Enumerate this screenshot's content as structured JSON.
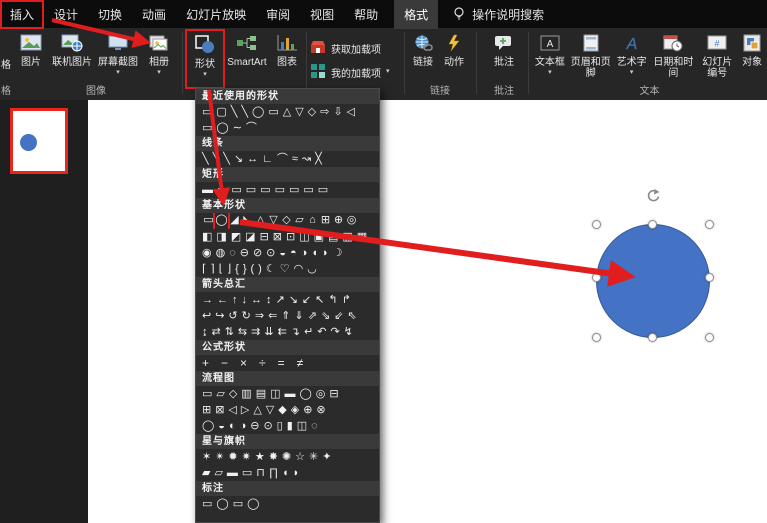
{
  "colors": {
    "annotation_red": "#e11d1d",
    "shape_blue": "#4472c4",
    "titlebar_bg": "#0c0c0c",
    "ribbon_bg": "#262626",
    "dropdown_bg": "#2b2b2b"
  },
  "icons": {
    "caret": "▾"
  },
  "titlebar": {
    "tabs": [
      {
        "label": "插入"
      },
      {
        "label": "设计"
      },
      {
        "label": "切换"
      },
      {
        "label": "动画"
      },
      {
        "label": "幻灯片放映"
      },
      {
        "label": "审阅"
      },
      {
        "label": "视图"
      },
      {
        "label": "帮助"
      },
      {
        "label": "格式"
      }
    ],
    "search_label": "操作说明搜索"
  },
  "ribbon": {
    "partial_button_label": "格",
    "partial_group_label": "格",
    "groups": {
      "images": {
        "label": "图像",
        "buttons": [
          "图片",
          "联机图片",
          "屏幕截图",
          "相册"
        ]
      },
      "illustrations": {
        "buttons": [
          "形状",
          "SmartArt",
          "图表"
        ]
      },
      "addins": {
        "buttons": [
          "获取加载项",
          "我的加载项"
        ]
      },
      "links": {
        "label": "链接",
        "buttons": [
          "链接",
          "动作"
        ]
      },
      "comments": {
        "label": "批注",
        "buttons": [
          "批注"
        ]
      },
      "text": {
        "label": "文本",
        "buttons": [
          "文本框",
          "页眉和页脚",
          "艺术字",
          "日期和时间",
          "幻灯片编号",
          "对象"
        ]
      }
    }
  },
  "shapes_menu": {
    "sections": {
      "recent": {
        "title": "最近使用的形状",
        "rows": [
          "▭▢╲╲◯▭△▽◇⇨⇩◁",
          "▭◯∼⌒"
        ]
      },
      "lines": {
        "title": "线条",
        "rows": [
          "╲╲╲↘↔∟⌒≈↝╳"
        ]
      },
      "rectangles": {
        "title": "矩形",
        "rows": [
          "▬▭▭▭▭▭▭▭▭"
        ]
      },
      "basic": {
        "title": "基本形状",
        "row1": [
          "▭",
          "◯",
          "◢",
          "◣",
          "△",
          "▽",
          "◇",
          "▱",
          "⌂",
          "⊞",
          "⊕",
          "◎"
        ],
        "rows": [
          "◧◨◩◪⊟⊠⊡◫▣▤▥▦",
          "◉◍◌⊖⊘⊙◒◓◑◖◗☽",
          "⌈⌉⌊⌋{}()☾♡◠◡"
        ]
      },
      "arrows": {
        "title": "箭头总汇",
        "rows": [
          "→←↑↓↔↕↗↘↙↖↰↱",
          "↩↪↺↻⇒⇐⇑⇓⇗⇘⇙⇖",
          "↨⇄⇅⇆⇉⇊⇇↴↵↶↷↯"
        ]
      },
      "equation": {
        "title": "公式形状",
        "rows": [
          "+−×÷=≠"
        ]
      },
      "flowchart": {
        "title": "流程图",
        "rows": [
          "▭▱◇▥▤◫▬◯◎⊟",
          "⊞⊠◁▷△▽◆◈⊕⊗",
          "◯◒◐◑⊖⊙▯▮◫◌"
        ]
      },
      "stars": {
        "title": "星与旗帜",
        "rows": [
          "✶✴✹✷★✸✺☆✳✦",
          "▰▱▬▭⊓∏◖◗"
        ]
      },
      "callouts": {
        "title": "标注",
        "rows": [
          "▭◯▭◯"
        ]
      }
    }
  },
  "canvas": {
    "selected_shape": "ellipse",
    "fill": "#4472c4"
  }
}
